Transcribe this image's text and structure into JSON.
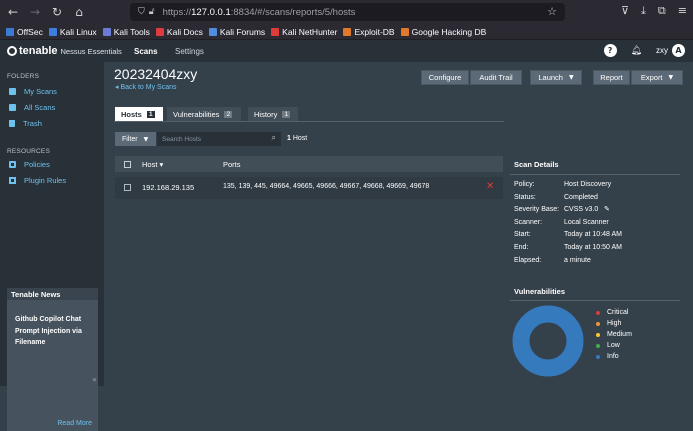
{
  "browser": {
    "url_prefix": "https://",
    "url_host": "127.0.0.1",
    "url_rest": ":8834/#/scans/reports/5/hosts"
  },
  "bookmarks": [
    {
      "label": "OffSec",
      "color": "#3b7bd4"
    },
    {
      "label": "Kali Linux",
      "color": "#3a7ee0"
    },
    {
      "label": "Kali Tools",
      "color": "#6b7cd8"
    },
    {
      "label": "Kali Docs",
      "color": "#e03b3b"
    },
    {
      "label": "Kali Forums",
      "color": "#4f8de0"
    },
    {
      "label": "Kali NetHunter",
      "color": "#e03b3b"
    },
    {
      "label": "Exploit-DB",
      "color": "#e07a2a"
    },
    {
      "label": "Google Hacking DB",
      "color": "#e07a2a"
    }
  ],
  "header": {
    "brand": "tenable",
    "product": "Nessus Essentials",
    "nav_scans": "Scans",
    "nav_settings": "Settings",
    "user": "zxy",
    "avatar_initial": "A"
  },
  "sidebar": {
    "folders_heading": "FOLDERS",
    "folders": [
      {
        "label": "My Scans"
      },
      {
        "label": "All Scans"
      },
      {
        "label": "Trash"
      }
    ],
    "resources_heading": "RESOURCES",
    "resources": [
      {
        "label": "Policies"
      },
      {
        "label": "Plugin Rules"
      }
    ],
    "news_title": "Tenable News",
    "news_body": "Github Copilot Chat Prompt Injection via Filename",
    "news_link": "Read More"
  },
  "main": {
    "title": "20232404zxy",
    "back": "◂ Back to My Scans",
    "buttons": {
      "configure": "Configure",
      "audit_trail": "Audit Trail",
      "launch": "Launch",
      "report": "Report",
      "export": "Export"
    },
    "tabs": [
      {
        "label": "Hosts",
        "count": "1"
      },
      {
        "label": "Vulnerabilities",
        "count": "2"
      },
      {
        "label": "History",
        "count": "1"
      }
    ],
    "filter_label": "Filter",
    "search_placeholder": "Search Hosts",
    "host_count_num": "1",
    "host_count_word": "Host",
    "columns": {
      "host": "Host ▾",
      "ports": "Ports"
    },
    "rows": [
      {
        "host": "192.168.29.135",
        "ports": "135, 139, 445, 49664, 49665, 49666, 49667, 49668, 49669, 49678"
      }
    ]
  },
  "details": {
    "title": "Scan Details",
    "items": [
      {
        "label": "Policy:",
        "value": "Host Discovery"
      },
      {
        "label": "Status:",
        "value": "Completed"
      },
      {
        "label": "Severity Base:",
        "value": "CVSS v3.0"
      },
      {
        "label": "Scanner:",
        "value": "Local Scanner"
      },
      {
        "label": "Start:",
        "value": "Today at 10:48 AM"
      },
      {
        "label": "End:",
        "value": "Today at 10:50 AM"
      },
      {
        "label": "Elapsed:",
        "value": "a minute"
      }
    ]
  },
  "vulnerabilities": {
    "title": "Vulnerabilities",
    "legend": [
      {
        "label": "Critical",
        "color": "#d43f3a"
      },
      {
        "label": "High",
        "color": "#ee9336"
      },
      {
        "label": "Medium",
        "color": "#fdc431"
      },
      {
        "label": "Low",
        "color": "#3fae49"
      },
      {
        "label": "Info",
        "color": "#357abd"
      }
    ],
    "info_share": 1.0
  }
}
